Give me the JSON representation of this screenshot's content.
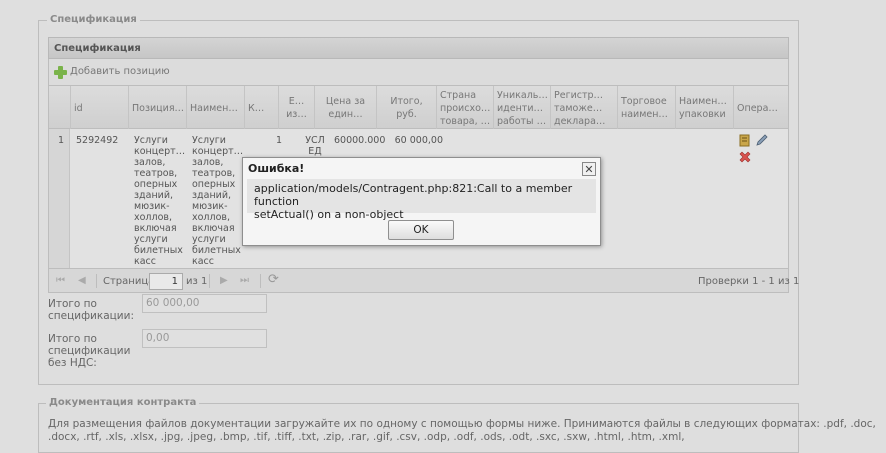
{
  "spec_section": {
    "legend": "Спецификация",
    "panel_title": "Спецификация",
    "add_position": "Добавить позицию",
    "columns": [
      "",
      "id",
      "Позиция…",
      "Наимен…",
      "К…",
      "Е… из…",
      "Цена за един…",
      "Итого, руб.",
      "Страна происхо… товара, …",
      "Уникаль… иденти… работы …",
      "Регистр… таможе… деклара…",
      "Торговое наимен…",
      "Наимен… упаковки",
      "Опера…"
    ],
    "row": {
      "num": "1",
      "id": "5292492",
      "position": "Услуги концерт… залов, театров, оперных зданий, мюзик-холлов, включая услуги билетных касс",
      "name": "Услуги концерт… залов, театров, оперных зданий, мюзик-холлов, включая услуги билетных касс",
      "qty": "1",
      "unit": "УСЛ ЕД",
      "price": "60000.000",
      "total": "60 000,00"
    },
    "pager": {
      "page_label": "Страница",
      "page_value": "1",
      "of_label": "из 1",
      "summary": "Проверки 1 - 1 из 1"
    },
    "total_label": "Итого по спецификации:",
    "total_value": "60 000,00",
    "total_no_vat_label": "Итого по спецификации без НДС:",
    "total_no_vat_value": "0,00"
  },
  "docs_section": {
    "legend": "Документация контракта",
    "text_line1": "Для размещения файлов документации загружайте их по одному с помощью формы ниже. Принимаются файлы в следующих форматах: .pdf, .doc,",
    "text_line2": ".docx, .rtf, .xls, .xlsx, .jpg, .jpeg, .bmp, .tif, .tiff, .txt, .zip, .rar, .gif, .csv, .odp, .odf, .ods, .odt, .sxc, .sxw, .html, .htm, .xml,"
  },
  "dialog": {
    "title": "Ошибка!",
    "message_line1": "application/models/Contragent.php:821:Call to a member function",
    "message_line2": "setActual() on a non-object",
    "ok_label": "OK",
    "close_glyph": "✕"
  },
  "icons": {
    "first": "⏮",
    "prev": "◀",
    "next": "▶",
    "last": "⏭",
    "refresh": "⟳"
  },
  "colors": {
    "overlay_bg": "#dfdfdf",
    "add_icon": "#7ab34a",
    "delete_icon": "#d9534f"
  }
}
